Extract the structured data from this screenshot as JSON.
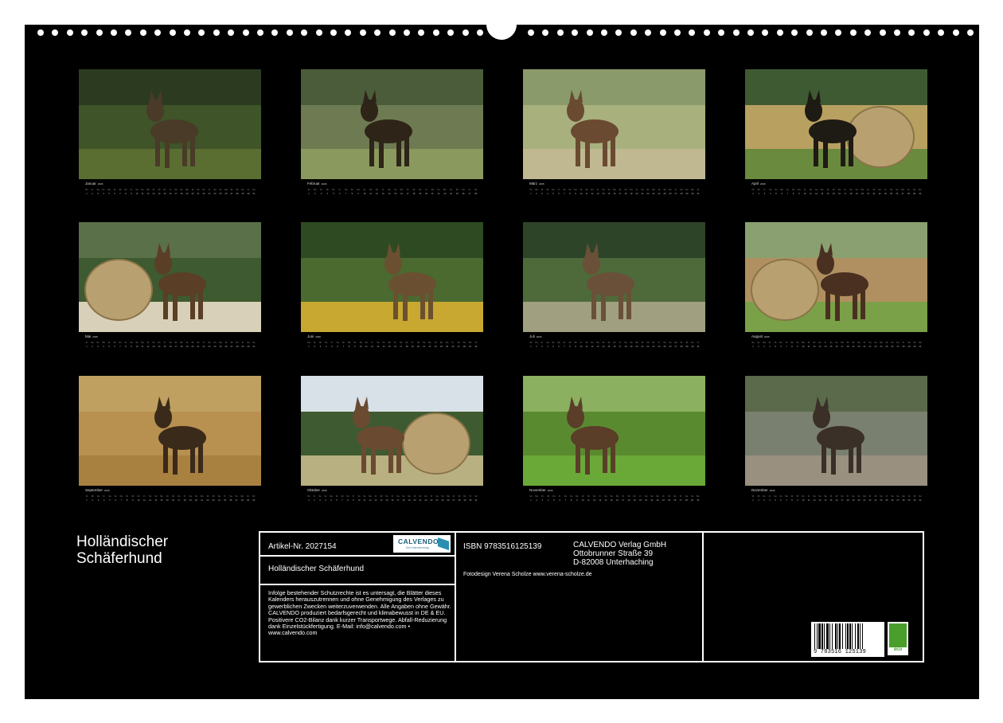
{
  "calendar": {
    "year": "2026",
    "months": [
      {
        "name": "Januar",
        "days": 31,
        "first_weekday": 3
      },
      {
        "name": "Februar",
        "days": 28,
        "first_weekday": 6
      },
      {
        "name": "März",
        "days": 31,
        "first_weekday": 6
      },
      {
        "name": "April",
        "days": 30,
        "first_weekday": 2
      },
      {
        "name": "Mai",
        "days": 31,
        "first_weekday": 4
      },
      {
        "name": "Juni",
        "days": 30,
        "first_weekday": 0
      },
      {
        "name": "Juli",
        "days": 31,
        "first_weekday": 2
      },
      {
        "name": "August",
        "days": 31,
        "first_weekday": 5
      },
      {
        "name": "September",
        "days": 30,
        "first_weekday": 1
      },
      {
        "name": "Oktober",
        "days": 31,
        "first_weekday": 3
      },
      {
        "name": "November",
        "days": 30,
        "first_weekday": 6
      },
      {
        "name": "Dezember",
        "days": 31,
        "first_weekday": 1
      }
    ],
    "weekday_abbr": [
      "Mo",
      "Di",
      "Mi",
      "Do",
      "Fr",
      "Sa",
      "So"
    ]
  },
  "title": {
    "line1": "Holländischer",
    "line2": "Schäferhund"
  },
  "info": {
    "article": "Artikel-Nr. 2027154",
    "logo_text": "CALVENDO",
    "logo_sub": "Dein Kalenderverlag",
    "product_title": "Holländischer Schäferhund",
    "legal": "Infolge bestehender Schutzrechte ist es untersagt, die Blätter dieses Kalenders herauszutrennen und ohne Genehmigung des Verlages zu gewerblichen Zwecken weiterzuverwenden. Alle Angaben ohne Gewähr. CALVENDO produziert bedarfsgerecht und klimabewusst in DE & EU. Positivere CO2-Bilanz dank kurzer Transportwege. Abfall-Reduzierung dank Einzelstückfertigung. E-Mail: info@calvendo.com • www.calvendo.com",
    "isbn": "ISBN 9783516125139",
    "publisher": "CALVENDO Verlag GmbH",
    "street": "Ottobrunner Straße 39",
    "city": "D-82008 Unterhaching",
    "photo_credit": "Fotodesign Verena Scholze www.verena-scholze.de",
    "barcode_number": "9 783516 125139",
    "eco_label": "eco"
  },
  "colors": {
    "background": "#000000",
    "text": "#ffffff",
    "brand": "#1a5e7a",
    "eco": "#4a9e2c"
  }
}
